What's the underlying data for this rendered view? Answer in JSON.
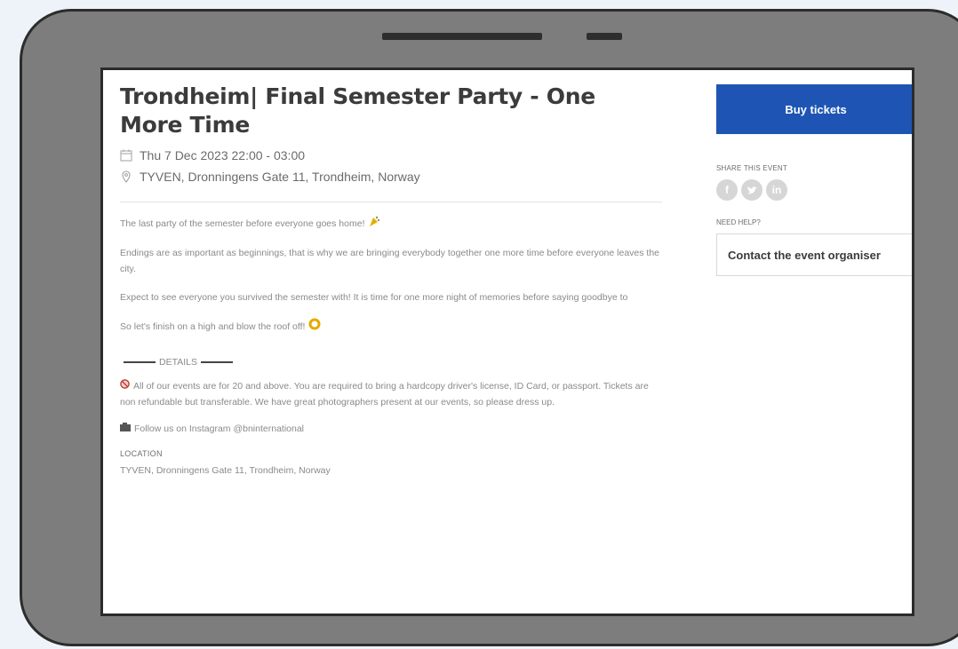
{
  "event": {
    "title": "Trondheim| Final Semester Party - One More Time",
    "datetime": "Thu 7 Dec 2023 22:00 - 03:00",
    "location": "TYVEN, Dronningens Gate 11, Trondheim, Norway"
  },
  "description": {
    "p1": "The last party of the semester before everyone goes home!",
    "p2": "Endings are as important as beginnings, that is why we are bringing everybody together one more time before everyone leaves the city.",
    "p3": "Expect to see everyone you survived the semester with! It is time for one more night of memories before saying goodbye to",
    "p4": "So let's finish on a high and blow the roof off!",
    "details_heading": "DETAILS",
    "p5": "All of our events are for 20 and above. You are required to bring a hardcopy driver's license, ID Card, or passport. Tickets are non refundable but transferable. We have great photographers present at our events, so please dress up.",
    "p6": "Follow us on Instagram @bninternational"
  },
  "location_section": {
    "label": "LOCATION",
    "address": "TYVEN, Dronningens Gate 11, Trondheim, Norway"
  },
  "sidebar": {
    "buy_label": "Buy tickets",
    "share_label": "SHARE THIS EVENT",
    "socials": [
      "facebook-icon",
      "twitter-icon",
      "linkedin-icon"
    ],
    "help_label": "NEED HELP?",
    "contact_label": "Contact the event organiser"
  },
  "colors": {
    "primary_button": "#1e55b4",
    "device_frame": "#7d7d7d"
  }
}
